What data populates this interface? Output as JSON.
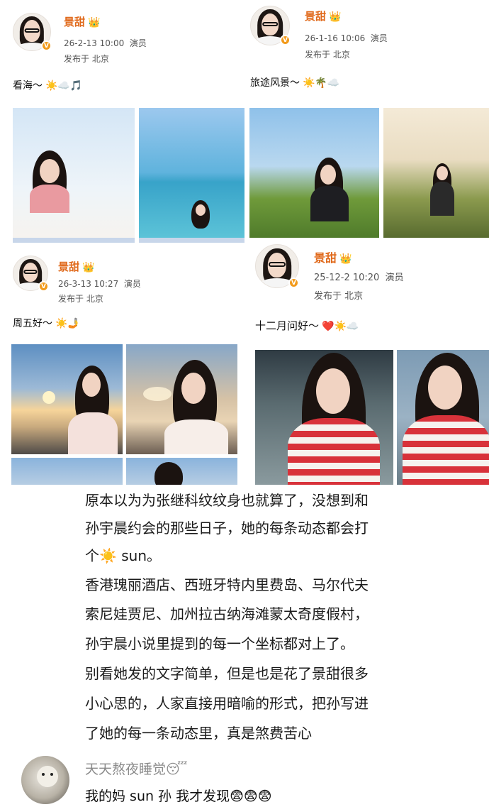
{
  "posts": [
    {
      "username": "景甜",
      "crown_icon": "crown-icon",
      "datetime": "26-2-13 10:00",
      "role": "演员",
      "location": "发布于 北京",
      "text": "看海～",
      "emojis": "☀️☁️🎵"
    },
    {
      "username": "景甜",
      "crown_icon": "crown-icon",
      "datetime": "26-1-16 10:06",
      "role": "演员",
      "location": "发布于 北京",
      "text": "旅途风景～",
      "emojis": "☀️🌴☁️"
    },
    {
      "username": "景甜",
      "crown_icon": "crown-icon",
      "datetime": "26-3-13 10:27",
      "role": "演员",
      "location": "发布于 北京",
      "text": "周五好～",
      "emojis": "☀️🤳"
    },
    {
      "username": "景甜",
      "crown_icon": "crown-icon",
      "datetime": "25-12-2 10:20",
      "role": "演员",
      "location": "发布于 北京",
      "text": "十二月问好～",
      "emojis": "❤️☀️☁️"
    }
  ],
  "verified_badge": "V",
  "article": {
    "lines": [
      "原本以为为张继科纹纹身也就算了，没想到和",
      "孙宇晨约会的那些日子，她的每条动态都会打",
      "个☀️ sun。",
      "香港瑰丽酒店、西班牙特内里费岛、马尔代夫",
      "索尼娃贾尼、加州拉古纳海滩蒙太奇度假村，",
      "孙宇晨小说里提到的每一个坐标都对上了。",
      "别看她发的文字简单，但是也是花了景甜很多",
      "小心思的，人家直接用暗喻的形式，把孙写进",
      "了她的每一条动态里，真是煞费苦心"
    ]
  },
  "comment": {
    "username": "天天熬夜睡觉😴",
    "text": "我的妈 sun 孙 我才发现😨😨😨"
  }
}
